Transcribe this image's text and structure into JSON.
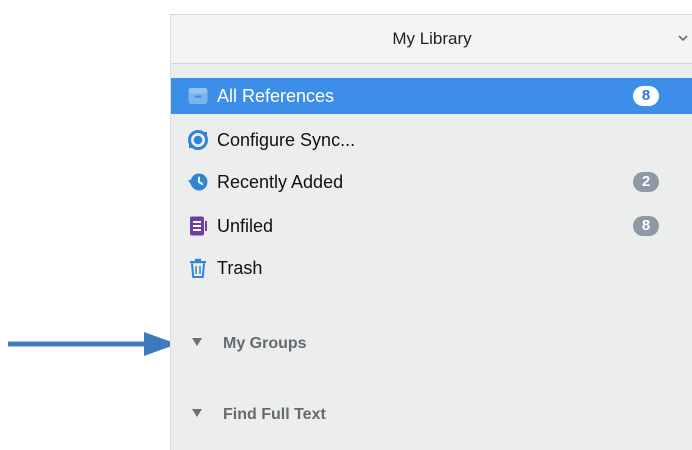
{
  "annotation": {
    "arrow_color": "#3e79bc"
  },
  "sidebar": {
    "library_title": "My Library",
    "library_icon": "chevron-down-icon",
    "items": [
      {
        "label": "All References",
        "badge": "8",
        "icon": "archive-box-icon",
        "selected": true
      },
      {
        "label": "Configure Sync...",
        "badge": "",
        "icon": "sync-icon",
        "selected": false
      },
      {
        "label": "Recently Added",
        "badge": "2",
        "icon": "history-clock-icon",
        "selected": false
      },
      {
        "label": "Unfiled",
        "badge": "8",
        "icon": "document-list-icon",
        "selected": false
      },
      {
        "label": "Trash",
        "badge": "",
        "icon": "trash-icon",
        "selected": false
      }
    ],
    "sections": [
      {
        "label": "My Groups",
        "icon": "disclosure-triangle-icon"
      },
      {
        "label": "Find Full Text",
        "icon": "disclosure-triangle-icon"
      }
    ],
    "colors": {
      "selection": "#3d8ee8",
      "badge": "#8f98a5",
      "icon_blue": "#2f84d8",
      "icon_purple": "#6c3fa0"
    }
  }
}
